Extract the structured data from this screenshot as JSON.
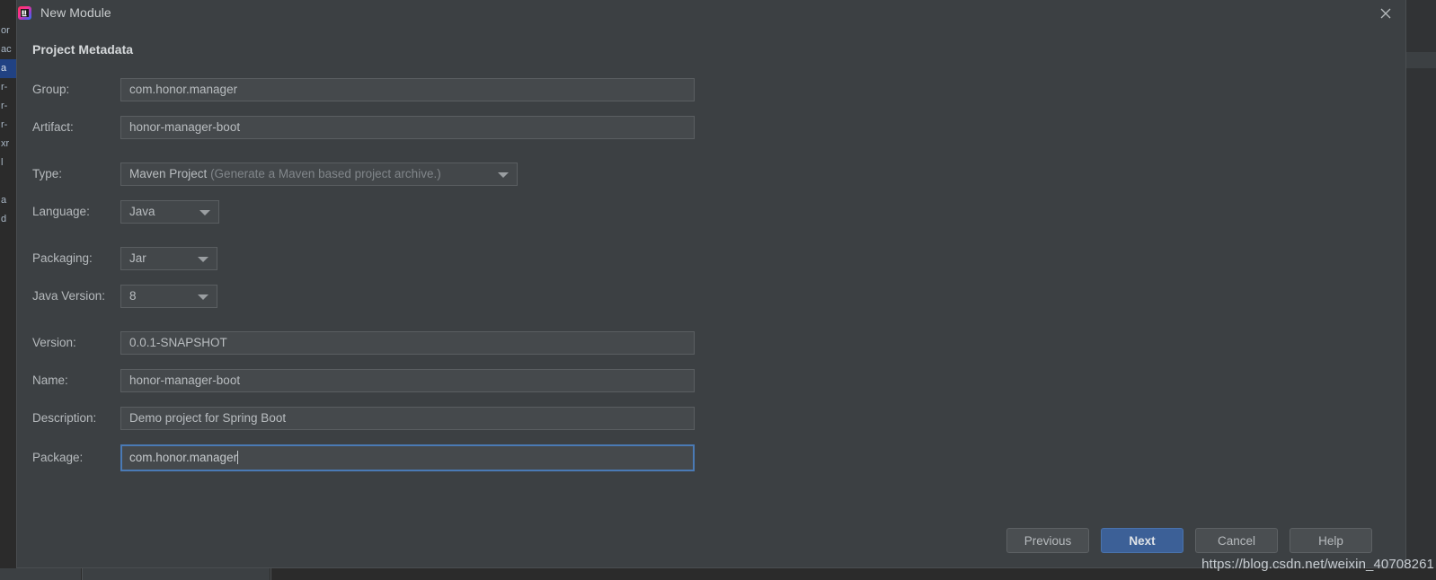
{
  "backdrop": {
    "editor_fragments": [
      "or",
      "ac",
      "a",
      "r-",
      "r-",
      "r-",
      "xr",
      "l",
      "",
      "a",
      "d"
    ],
    "selected_fragment_index": 2
  },
  "dialog": {
    "title": "New Module",
    "title_icon": "intellij-idea-icon",
    "close_icon": "close-icon",
    "section_title": "Project Metadata",
    "fields": [
      {
        "label": "Group:",
        "value": "com.honor.manager",
        "kind": "text",
        "focused": false
      },
      {
        "label": "Artifact:",
        "value": "honor-manager-boot",
        "kind": "text",
        "focused": false
      },
      {
        "label": "Type:",
        "value": "Maven Project",
        "hint": "(Generate a Maven based project archive.)",
        "kind": "combo-wide"
      },
      {
        "label": "Language:",
        "value": "Java",
        "kind": "combo-narrow"
      },
      {
        "label": "Packaging:",
        "value": "Jar",
        "kind": "combo-narrow2"
      },
      {
        "label": "Java Version:",
        "value": "8",
        "kind": "combo-narrow2"
      },
      {
        "label": "Version:",
        "value": "0.0.1-SNAPSHOT",
        "kind": "text",
        "focused": false
      },
      {
        "label": "Name:",
        "value": "honor-manager-boot",
        "kind": "text",
        "focused": false
      },
      {
        "label": "Description:",
        "value": "Demo project for Spring Boot",
        "kind": "text",
        "focused": false
      },
      {
        "label": "Package:",
        "value": "com.honor.manager",
        "kind": "text",
        "focused": true
      }
    ],
    "buttons": [
      {
        "label": "Previous",
        "primary": false
      },
      {
        "label": "Next",
        "primary": true
      },
      {
        "label": "Cancel",
        "primary": false
      },
      {
        "label": "Help",
        "primary": false
      }
    ]
  },
  "watermark": "https://blog.csdn.net/weixin_40708261",
  "colors": {
    "dialog_bg": "#3c4043",
    "ide_bg": "#2b2b2b",
    "field_bg": "#45494c",
    "field_border": "#5a5e61",
    "focus_border": "#4a7ab5",
    "primary_button": "#3c6097",
    "text": "#b6babd",
    "selection": "#214283"
  }
}
